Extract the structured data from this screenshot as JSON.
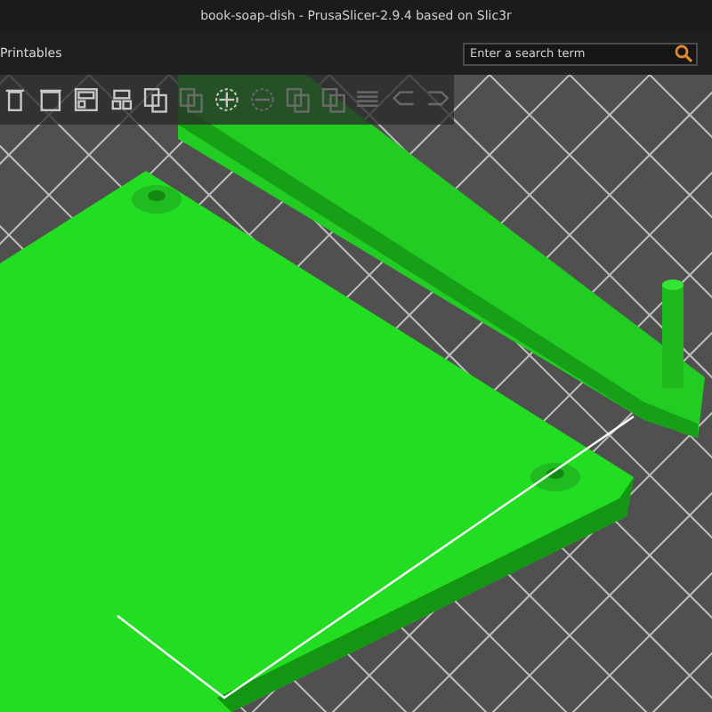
{
  "window": {
    "title": "book-soap-dish - PrusaSlicer-2.9.4 based on Slic3r"
  },
  "menu_bar": {
    "label": "Printables"
  },
  "search": {
    "placeholder": "Enter a search term"
  },
  "toolbar": [
    {
      "kind": "delete-all",
      "disabled": false
    },
    {
      "kind": "trash",
      "disabled": false
    },
    {
      "kind": "arrange",
      "disabled": false
    },
    {
      "kind": "arrange-selection",
      "disabled": false
    },
    {
      "kind": "copy",
      "disabled": false
    },
    {
      "kind": "paste",
      "disabled": true
    },
    {
      "kind": "add",
      "disabled": false
    },
    {
      "kind": "remove",
      "disabled": true
    },
    {
      "kind": "split-objects",
      "disabled": true
    },
    {
      "kind": "split-parts",
      "disabled": true
    },
    {
      "kind": "layers",
      "disabled": true
    },
    {
      "kind": "undo",
      "disabled": true
    },
    {
      "kind": "redo",
      "disabled": true
    }
  ]
}
